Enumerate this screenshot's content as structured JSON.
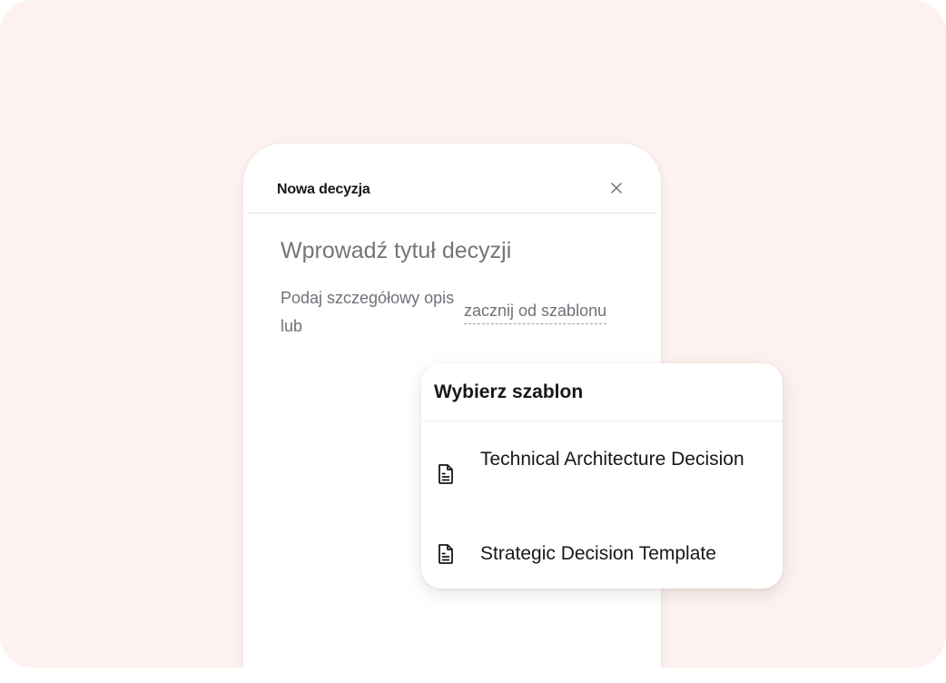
{
  "dialog": {
    "title": "Nowa decyzja",
    "close_icon": "close-icon",
    "title_placeholder": "Wprowadź tytuł decyzji",
    "description_prompt": "Podaj szczegółowy opis lub",
    "template_link": "zacznij od szablonu"
  },
  "template_picker": {
    "title": "Wybierz szablon",
    "options": [
      {
        "label": "Technical Architecture Decision",
        "icon": "document-icon"
      },
      {
        "label": "Strategic Decision Template",
        "icon": "document-icon"
      }
    ]
  },
  "colors": {
    "background": "#fdf2ef",
    "card": "#ffffff",
    "text_primary": "#18181b",
    "text_muted": "#71717a"
  }
}
